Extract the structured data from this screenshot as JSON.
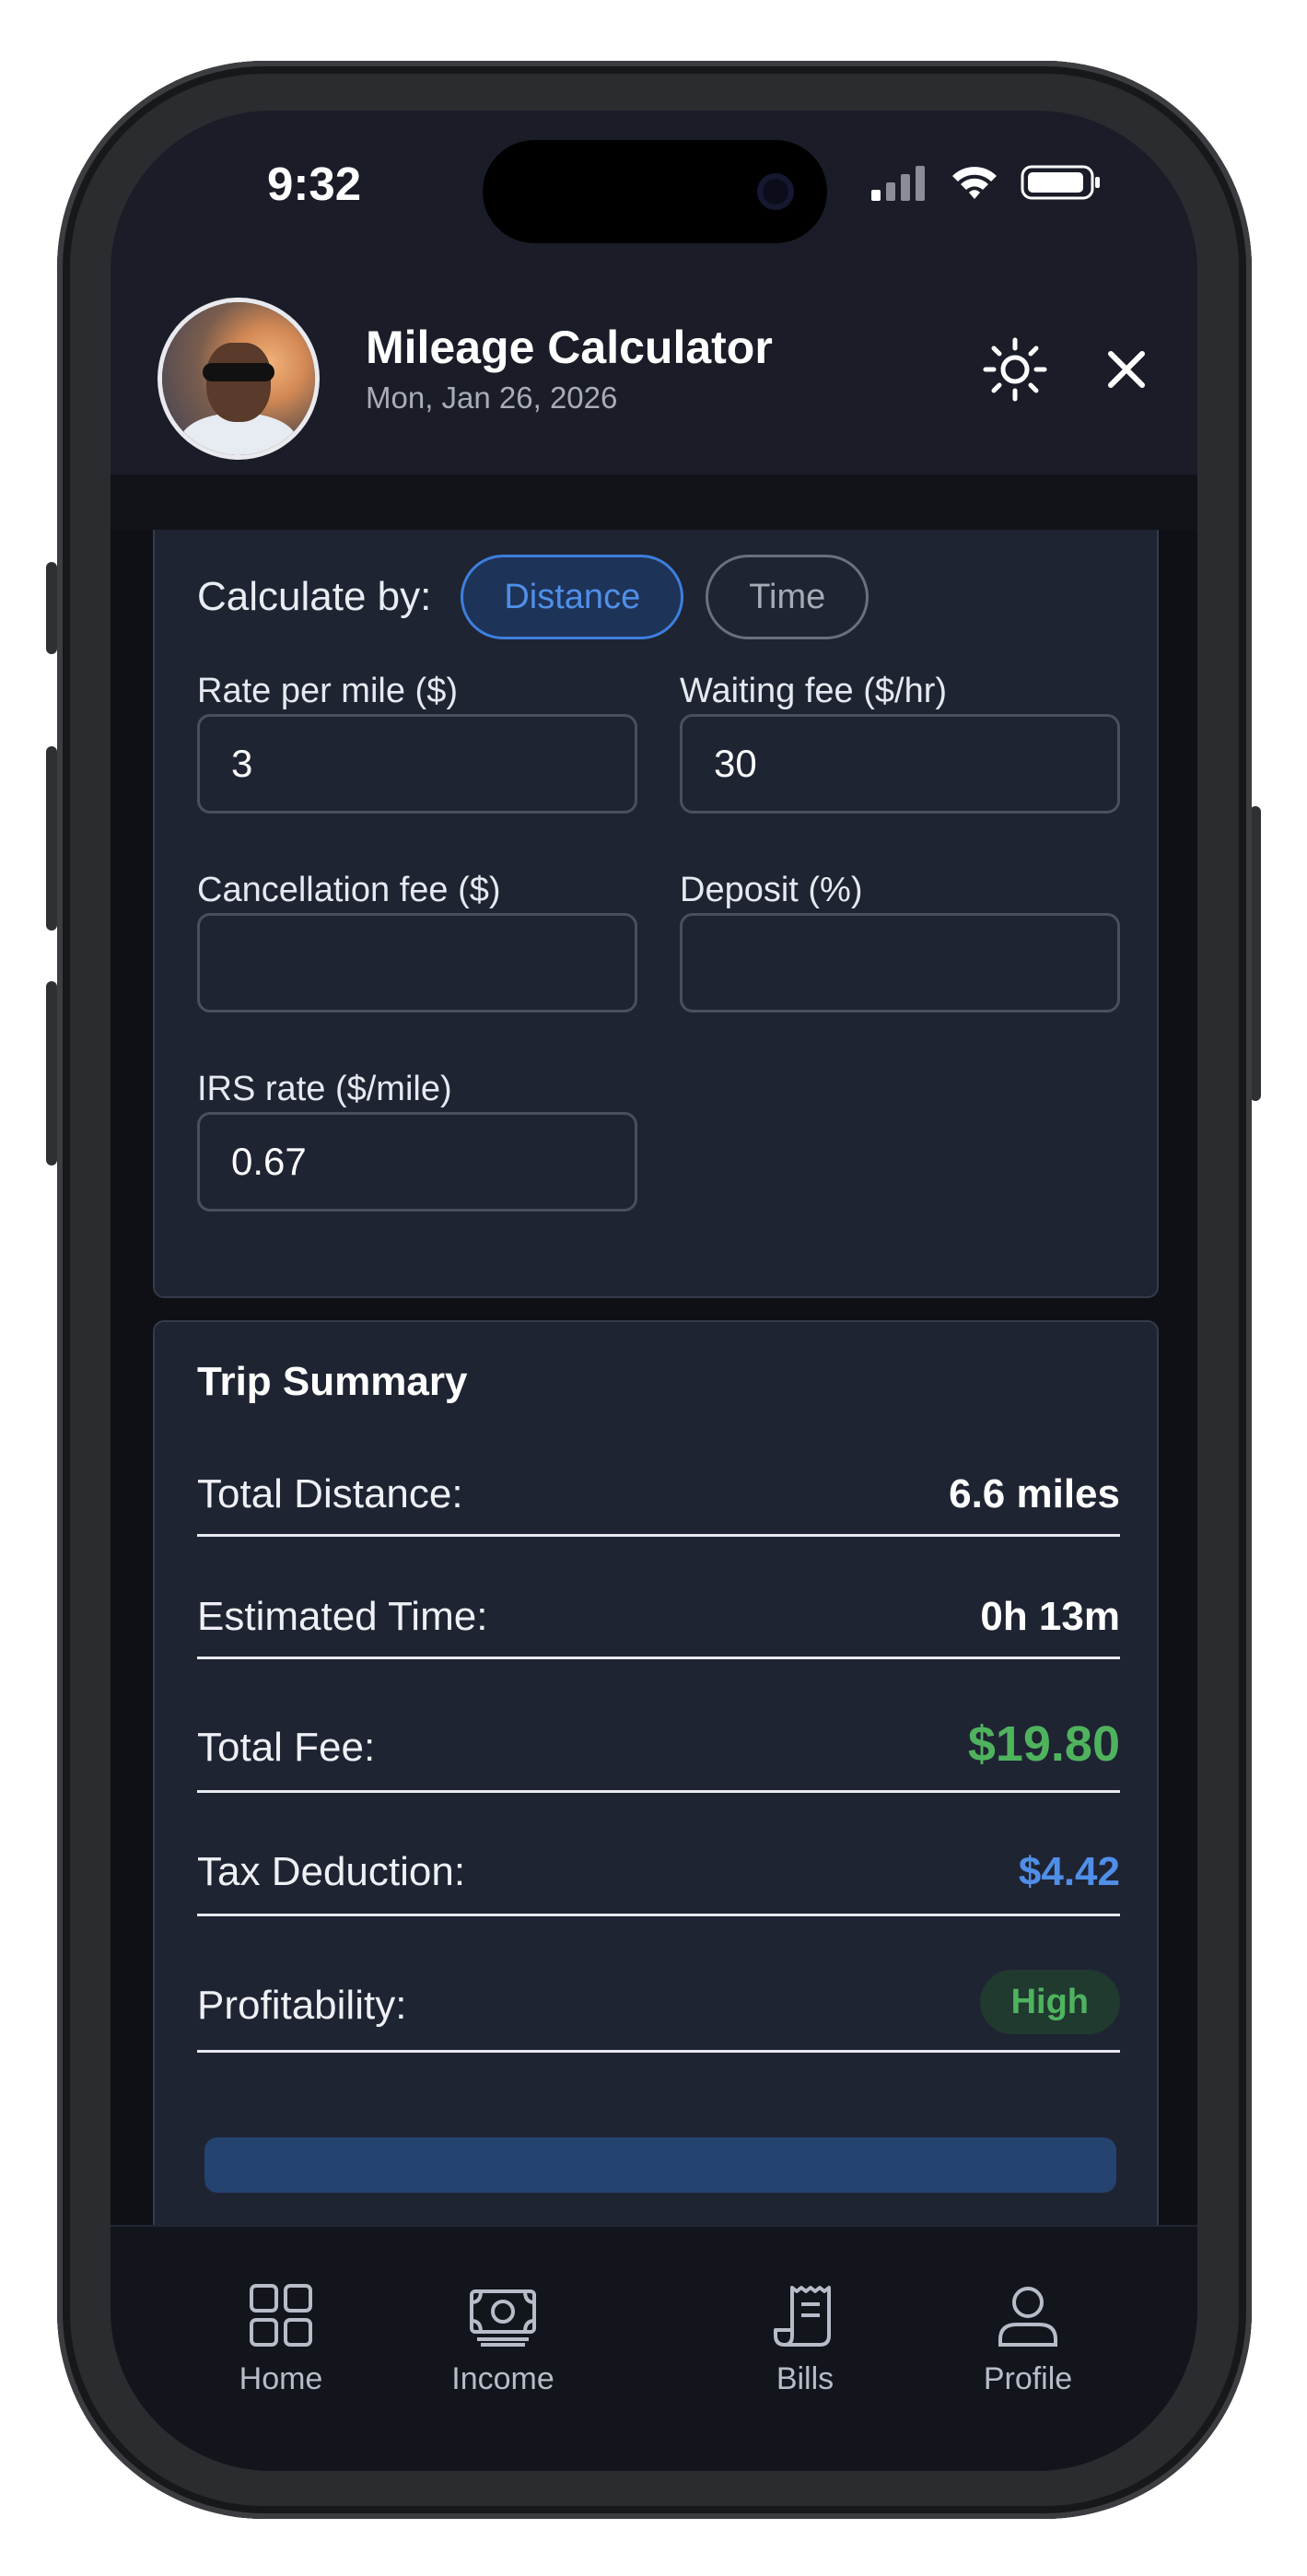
{
  "status_bar": {
    "time": "9:32"
  },
  "header": {
    "title": "Mileage Calculator",
    "date": "Mon, Jan 26, 2026",
    "theme_icon": "sun-icon",
    "close_icon": "close-icon"
  },
  "calculate_by": {
    "label": "Calculate by:",
    "options": [
      "Distance",
      "Time"
    ],
    "selected": "Distance"
  },
  "fields": {
    "rate_per_mile": {
      "label": "Rate per mile ($)",
      "value": "3"
    },
    "waiting_fee": {
      "label": "Waiting fee ($/hr)",
      "value": "30"
    },
    "cancellation_fee": {
      "label": "Cancellation fee ($)",
      "value": ""
    },
    "deposit": {
      "label": "Deposit (%)",
      "value": ""
    },
    "irs_rate": {
      "label": "IRS rate ($/mile)",
      "value": "0.67"
    }
  },
  "summary": {
    "title": "Trip Summary",
    "rows": [
      {
        "label": "Total Distance:",
        "value": "6.6 miles"
      },
      {
        "label": "Estimated Time:",
        "value": "0h 13m"
      },
      {
        "label": "Total Fee:",
        "value": "$19.80"
      },
      {
        "label": "Tax Deduction:",
        "value": "$4.42"
      },
      {
        "label": "Profitability:",
        "value": "High"
      }
    ]
  },
  "colors": {
    "accent_blue": "#4f8fe8",
    "total_fee_green": "#4fb35e",
    "background": "#1a1d28"
  },
  "tabbar": {
    "items": [
      {
        "label": "Home",
        "icon": "grid-icon"
      },
      {
        "label": "Income",
        "icon": "banknote-icon"
      },
      {
        "label": "Bills",
        "icon": "receipt-icon"
      },
      {
        "label": "Profile",
        "icon": "person-icon"
      }
    ]
  }
}
